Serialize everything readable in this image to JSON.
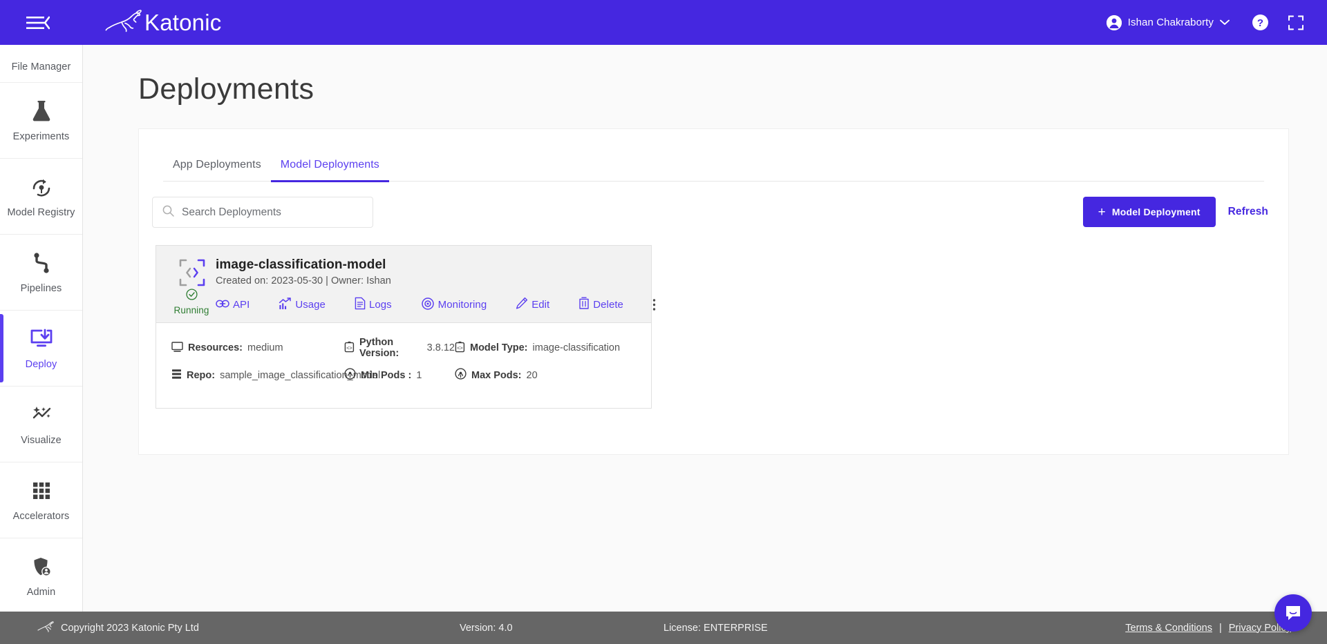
{
  "topbar": {
    "menu_icon": "hamburger-menu-icon",
    "brand": "Katonic",
    "user_name": "Ishan Chakraborty",
    "help_icon": "help-circle-icon",
    "fullscreen_icon": "fullscreen-icon",
    "brand_color": "#4527e0"
  },
  "sidebar": {
    "items": [
      {
        "label": "File Manager",
        "icon": "folder-icon",
        "active": false
      },
      {
        "label": "Experiments",
        "icon": "flask-icon",
        "active": false
      },
      {
        "label": "Model Registry",
        "icon": "model-registry-icon",
        "active": false
      },
      {
        "label": "Pipelines",
        "icon": "pipelines-icon",
        "active": false
      },
      {
        "label": "Deploy",
        "icon": "deploy-icon",
        "active": true
      },
      {
        "label": "Visualize",
        "icon": "visualize-icon",
        "active": false
      },
      {
        "label": "Accelerators",
        "icon": "grid-icon",
        "active": false
      },
      {
        "label": "Admin",
        "icon": "admin-user-icon",
        "active": false
      }
    ],
    "active_color": "#5b3ff0"
  },
  "page": {
    "title": "Deployments"
  },
  "tabs": [
    {
      "label": "App Deployments",
      "active": false
    },
    {
      "label": "Model Deployments",
      "active": true
    }
  ],
  "search": {
    "placeholder": "Search Deployments",
    "value": "",
    "icon": "search-icon"
  },
  "toolbar": {
    "add_label": "Model Deployment",
    "add_plus": "+",
    "refresh_label": "Refresh"
  },
  "deployment": {
    "name": "image-classification-model",
    "subtitle": "Created on: 2023-05-30 | Owner: Ishan",
    "status": "Running",
    "status_color": "#2e7d32",
    "icon": "code-brackets-icon",
    "actions": [
      {
        "label": "API",
        "icon": "link-icon"
      },
      {
        "label": "Usage",
        "icon": "chart-bar-icon"
      },
      {
        "label": "Logs",
        "icon": "document-icon"
      },
      {
        "label": "Monitoring",
        "icon": "eye-icon"
      },
      {
        "label": "Edit",
        "icon": "pencil-icon"
      },
      {
        "label": "Delete",
        "icon": "trash-icon"
      }
    ],
    "more_icon": "kebab-menu-icon",
    "meta": {
      "resources_label": "Resources:",
      "resources_value": "medium",
      "python_label": "Python Version:",
      "python_value": "3.8.12",
      "model_type_label": "Model Type:",
      "model_type_value": "image-classification",
      "repo_label": "Repo:",
      "repo_value": "sample_image_classification_model",
      "min_pods_label": "Min Pods :",
      "min_pods_value": "1",
      "max_pods_label": "Max Pods:",
      "max_pods_value": "20"
    }
  },
  "footer": {
    "copyright": "Copyright 2023 Katonic Pty Ltd",
    "version": "Version: 4.0",
    "license": "License: ENTERPRISE",
    "terms": "Terms & Conditions",
    "separator": "|",
    "privacy": "Privacy Policy"
  },
  "chat": {
    "icon": "chat-bubble-icon"
  }
}
